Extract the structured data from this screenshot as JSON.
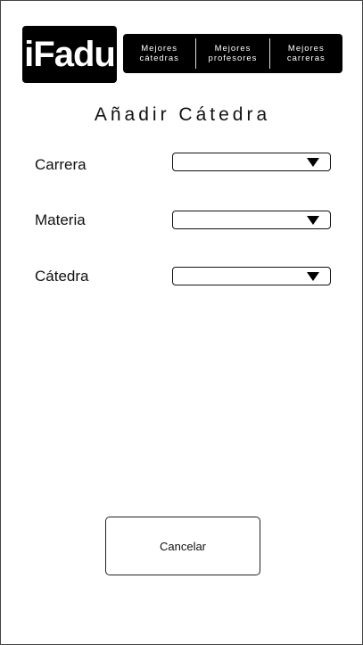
{
  "brand": {
    "logo_text": "iFadu"
  },
  "nav": {
    "items": [
      {
        "label": "Mejores\ncátedras"
      },
      {
        "label": "Mejores\nprofesores"
      },
      {
        "label": "Mejores\ncarreras"
      }
    ]
  },
  "page": {
    "title": "Añadir Cátedra"
  },
  "form": {
    "fields": [
      {
        "label": "Carrera",
        "value": ""
      },
      {
        "label": "Materia",
        "value": ""
      },
      {
        "label": "Cátedra",
        "value": ""
      }
    ]
  },
  "actions": {
    "cancel_label": "Cancelar"
  }
}
